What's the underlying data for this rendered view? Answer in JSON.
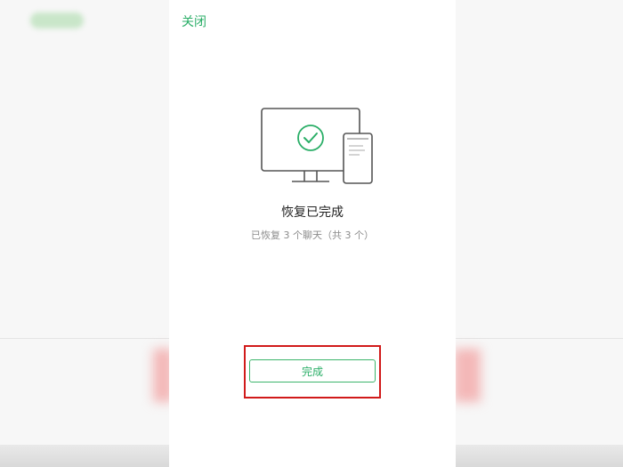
{
  "header": {
    "close_label": "关闭"
  },
  "status": {
    "title": "恢复已完成",
    "subtitle": "已恢复 3 个聊天（共 3 个）"
  },
  "actions": {
    "done_label": "完成"
  },
  "colors": {
    "accent": "#2aae67",
    "highlight_box": "#d11a1a",
    "title_text": "#222222",
    "subtitle_text": "#8c8c8c"
  },
  "icons": {
    "illustration": "monitor-phone-sync-icon",
    "check": "check-circle-icon"
  }
}
